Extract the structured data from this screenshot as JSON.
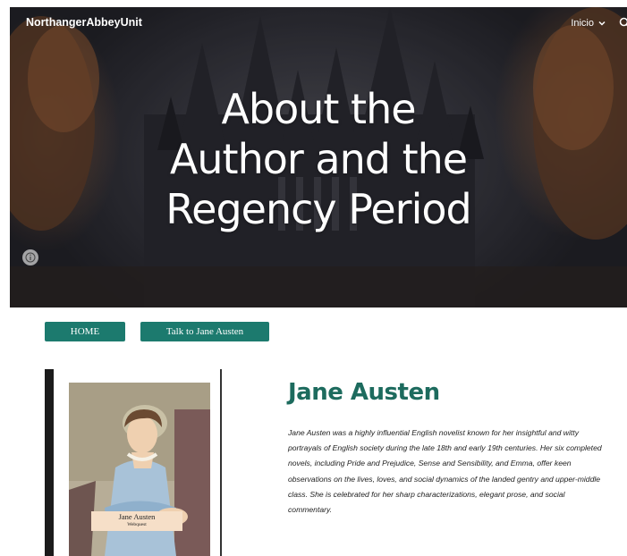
{
  "header": {
    "site_title": "NorthangerAbbeyUnit",
    "nav_item": "Inicio",
    "icons": [
      "chevron-down-icon",
      "search-icon",
      "info-icon"
    ]
  },
  "hero": {
    "line1": "About the",
    "line2": "Author and the",
    "line3": "Regency Period"
  },
  "buttons": {
    "home": "HOME",
    "talk": "Talk to Jane Austen"
  },
  "portrait_card": {
    "label_line1": "Jane Austen",
    "label_line2": "Webquest"
  },
  "author": {
    "name": "Jane Austen",
    "bio": "Jane Austen was a highly influential English novelist known for her insightful and witty portrayals of English society during the late 18th and early 19th centuries. Her six completed novels, including Pride and Prejudice, Sense and Sensibility, and Emma, offer keen observations on the lives, loves, and social dynamics of the landed gentry and upper-middle class. She is celebrated for her sharp characterizations, elegant prose, and social commentary."
  },
  "colors": {
    "accent": "#1c7a6e",
    "heading": "#1d6b5e",
    "label_bg": "#f6dfc8"
  }
}
